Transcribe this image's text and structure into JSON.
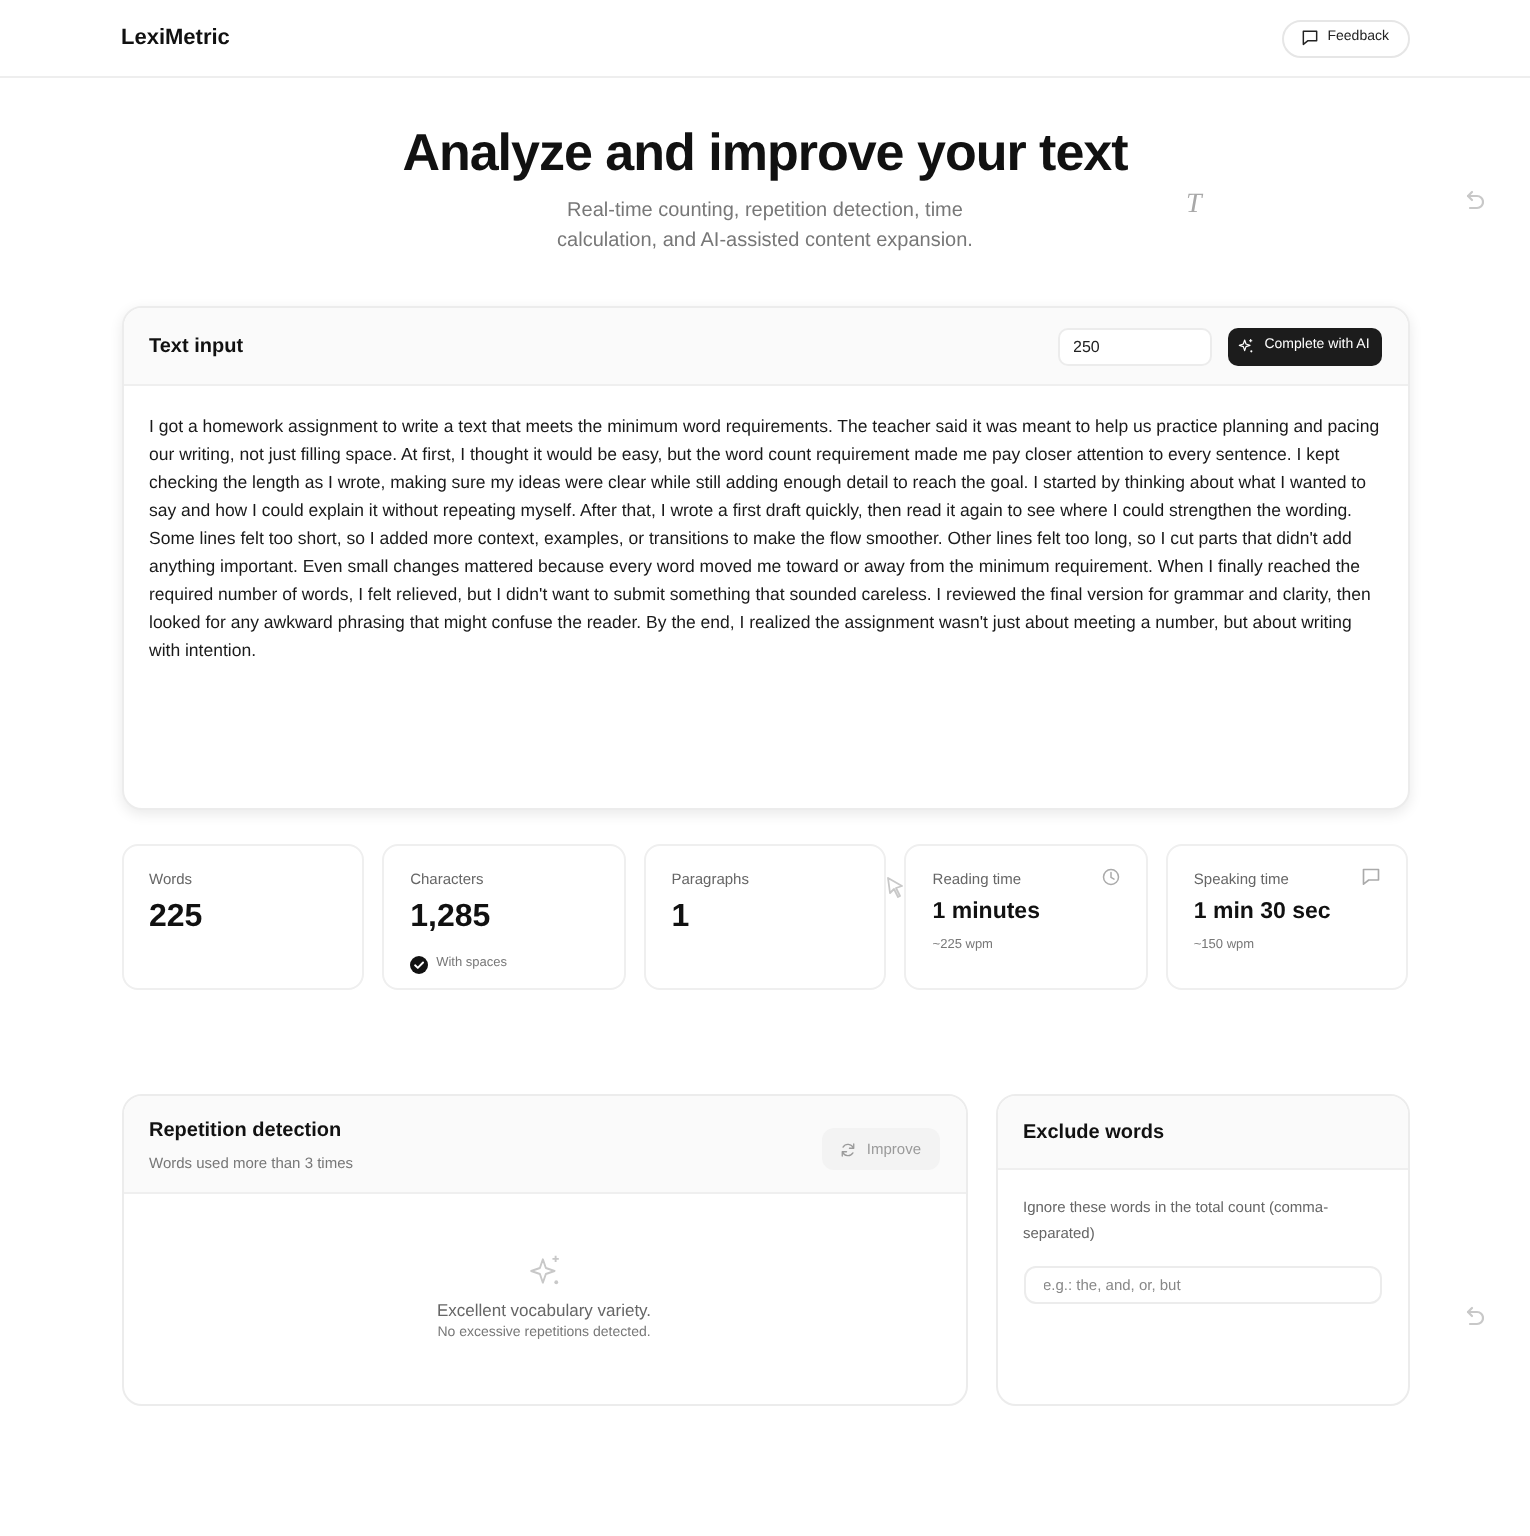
{
  "header": {
    "brand": "LexiMetric",
    "feedback_button": "Feedback"
  },
  "hero": {
    "title": "Analyze and improve your text",
    "subtitle": "Real-time counting, repetition detection, time calculation, and AI-assisted content expansion."
  },
  "background_letter": "T",
  "text_input": {
    "title": "Text input",
    "target_words": "250",
    "complete_button": "Complete with AI",
    "text": "I got a homework assignment to write a text that meets the minimum word requirements. The teacher said it was meant to help us practice planning and pacing our writing, not just filling space. At first, I thought it would be easy, but the word count requirement made me pay closer attention to every sentence. I kept checking the length as I wrote, making sure my ideas were clear while still adding enough detail to reach the goal. I started by thinking about what I wanted to say and how I could explain it without repeating myself. After that, I wrote a first draft quickly, then read it again to see where I could strengthen the wording. Some lines felt too short, so I added more context, examples, or transitions to make the flow smoother. Other lines felt too long, so I cut parts that didn't add anything important. Even small changes mattered because every word moved me toward or away from the minimum requirement. When I finally reached the required number of words, I felt relieved, but I didn't want to submit something that sounded careless. I reviewed the final version for grammar and clarity, then looked for any awkward phrasing that might confuse the reader. By the end, I realized the assignment wasn't just about meeting a number, but about writing with intention."
  },
  "stats": [
    {
      "kind": "count",
      "label": "Words",
      "value": "225"
    },
    {
      "kind": "checked",
      "label": "Characters",
      "value": "1,285",
      "note": "With spaces",
      "checked": true
    },
    {
      "kind": "count",
      "label": "Paragraphs",
      "value": "1"
    },
    {
      "kind": "reading",
      "label": "Reading time",
      "value": "1 minutes",
      "note": "~225 wpm"
    },
    {
      "kind": "speaking",
      "label": "Speaking time",
      "value": "1 min 30 sec",
      "note": "~150 wpm"
    }
  ],
  "repetition": {
    "title": "Repetition detection",
    "subtitle": "Words used more than 3 times",
    "improve_button": {
      "label": "Improve",
      "disabled": true
    },
    "empty_title": "Excellent vocabulary variety.",
    "empty_note": "No excessive repetitions detected."
  },
  "exclude": {
    "title": "Exclude words",
    "hint": "Ignore these words in the total count (comma-separated)",
    "placeholder": "e.g.: the, and, or, but"
  }
}
